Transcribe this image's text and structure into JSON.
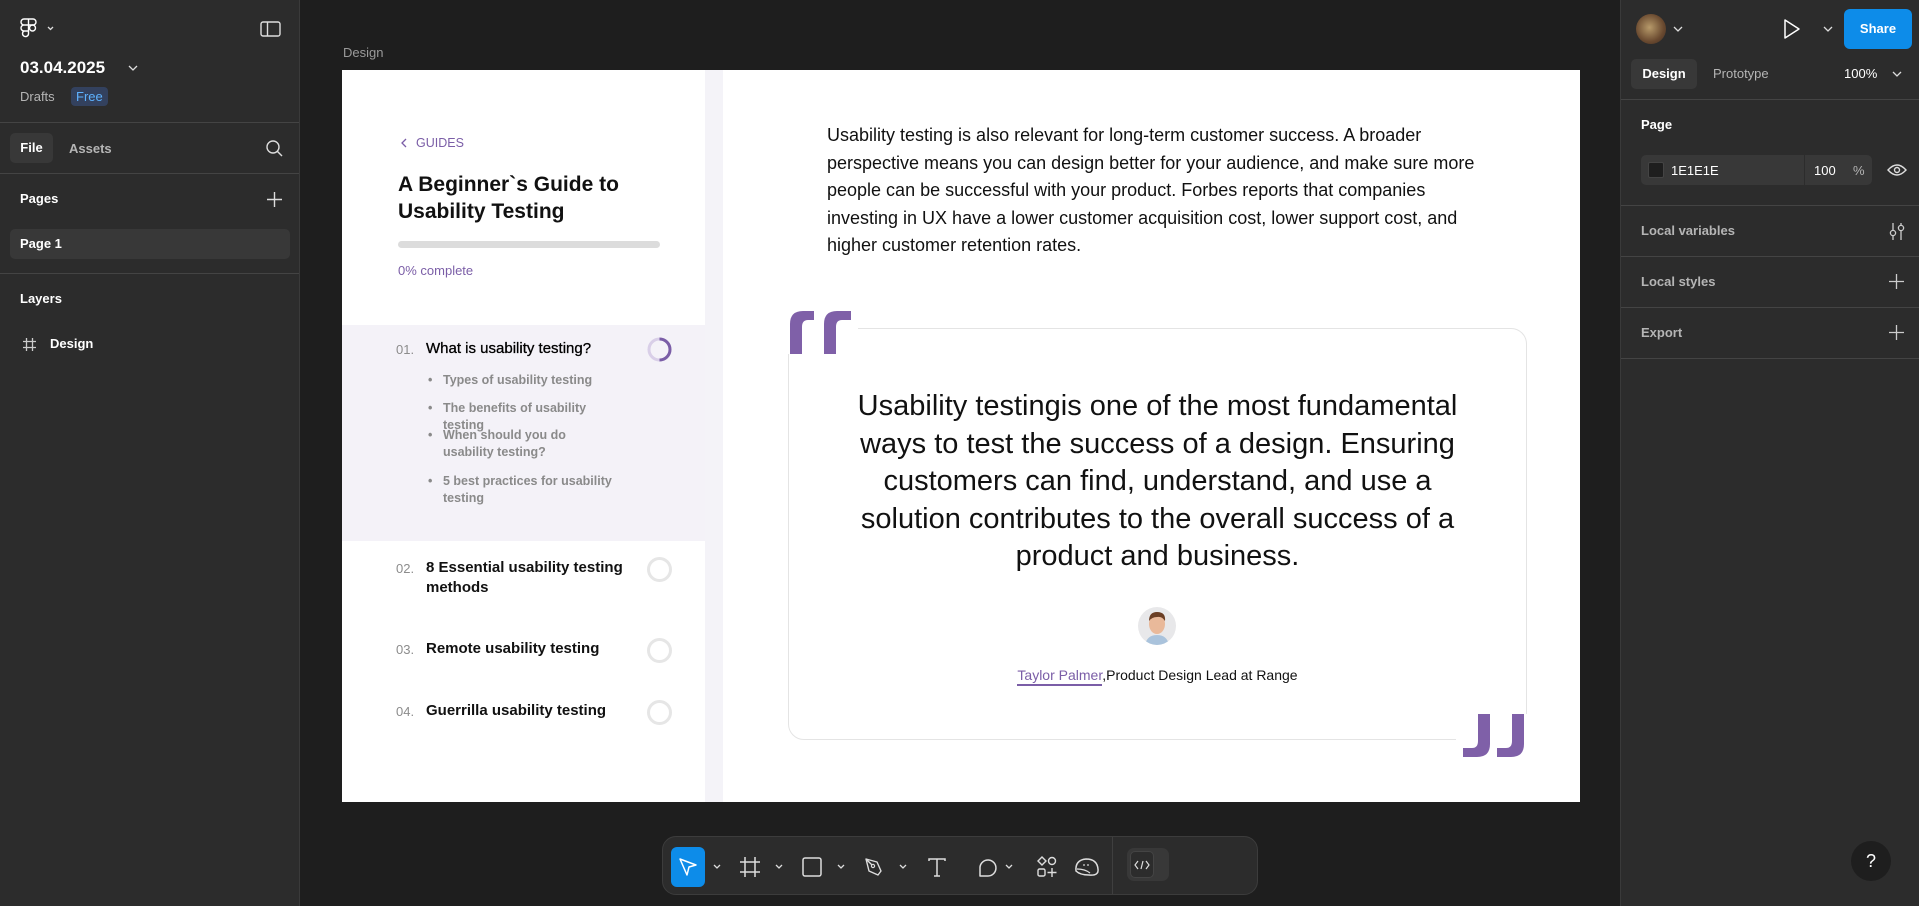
{
  "left_panel": {
    "file_name": "03.04.2025",
    "location": "Drafts",
    "plan_badge": "Free",
    "tabs": [
      "File",
      "Assets"
    ],
    "pages_label": "Pages",
    "pages": [
      "Page 1"
    ],
    "layers_label": "Layers",
    "layers": [
      "Design"
    ]
  },
  "right_panel": {
    "share_label": "Share",
    "tabs": [
      "Design",
      "Prototype"
    ],
    "zoom": "100%",
    "page_label": "Page",
    "page_color": "1E1E1E",
    "page_opacity": "100",
    "percent": "%",
    "sections": [
      "Local variables",
      "Local styles",
      "Export"
    ]
  },
  "canvas": {
    "frame_label": "Design",
    "guide": {
      "back_label": "GUIDES",
      "title_lines": [
        "A Beginner`s Guide to",
        "Usability Testing"
      ],
      "progress_percent": 0,
      "progress_label": "0% complete",
      "chapters": [
        {
          "num": "01.",
          "title": "What is usability testing?",
          "subitems": [
            "Types of usability testing",
            "The benefits of usability testing",
            "When should you do usability testing?",
            "5 best practices for usability testing"
          ]
        },
        {
          "num": "02.",
          "title": "8 Essential usability testing methods"
        },
        {
          "num": "03.",
          "title": "Remote usability testing"
        },
        {
          "num": "04.",
          "title": "Guerrilla usability testing"
        }
      ]
    },
    "paragraph_lines": [
      "Usability testing is also relevant for long-term customer success. A broader",
      "perspective means you can design better for your audience, and make sure more",
      "people can be successful with your product. Forbes reports that companies",
      "investing in UX have a lower customer acquisition cost, lower support cost, and",
      "higher customer retention rates."
    ],
    "quote_lines": [
      "Usability testingis one of the most fundamental",
      "ways to test the success of a design. Ensuring",
      "customers can find, understand, and use a",
      "solution contributes to the overall success of a",
      "product and business."
    ],
    "author_name": "Taylor Palmer",
    "author_role": ",Product Design Lead at Range"
  },
  "colors": {
    "accent": "#0d99ff",
    "brand_purple": "#7b5ea7",
    "canvas": "#1e1e1e"
  },
  "help_label": "?"
}
